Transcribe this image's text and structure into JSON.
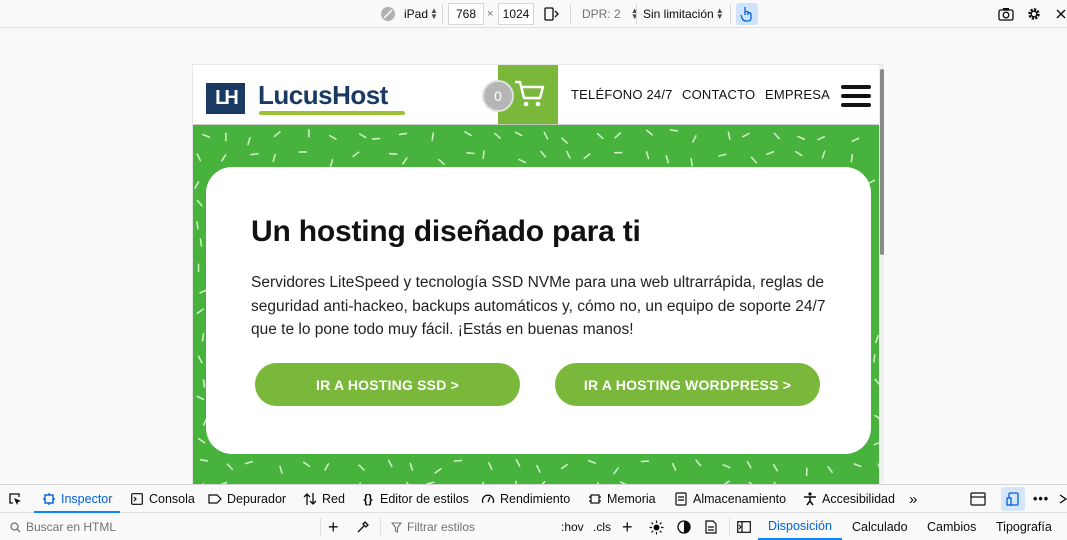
{
  "rdm_toolbar": {
    "device": "iPad",
    "width": "768",
    "times": "×",
    "height": "1024",
    "dpr": "DPR: 2",
    "throttling": "Sin limitación"
  },
  "site": {
    "logo_mark": "LH",
    "logo_text": "LucusHost",
    "cart_count": "0",
    "nav": [
      "TELÉFONO 24/7",
      "CONTACTO",
      "EMPRESA"
    ],
    "hero": {
      "title": "Un hosting diseñado para ti",
      "body": "Servidores LiteSpeed y tecnología SSD NVMe para una web ultrarrápida, reglas de seguridad anti-hackeo, backups automáticos y, cómo no, un equipo de soporte 24/7 que te lo pone todo muy fácil. ¡Estás en buenas manos!",
      "cta1": "IR A HOSTING SSD  >",
      "cta2": "IR A HOSTING WORDPRESS  >"
    }
  },
  "devtools": {
    "tabs": [
      "Inspector",
      "Consola",
      "Depurador",
      "Red",
      "Editor de estilos",
      "Rendimiento",
      "Memoria",
      "Almacenamiento",
      "Accesibilidad"
    ],
    "search_placeholder": "Buscar en HTML",
    "filter_placeholder": "Filtrar estilos",
    "hov": ":hov",
    "cls": ".cls",
    "side_tabs": [
      "Disposición",
      "Calculado",
      "Cambios",
      "Tipografía"
    ]
  },
  "colors": {
    "accent_green": "#7ab83b",
    "hero_green": "#47b23c",
    "brand_navy": "#1b3a63",
    "devtools_blue": "#0060df"
  }
}
